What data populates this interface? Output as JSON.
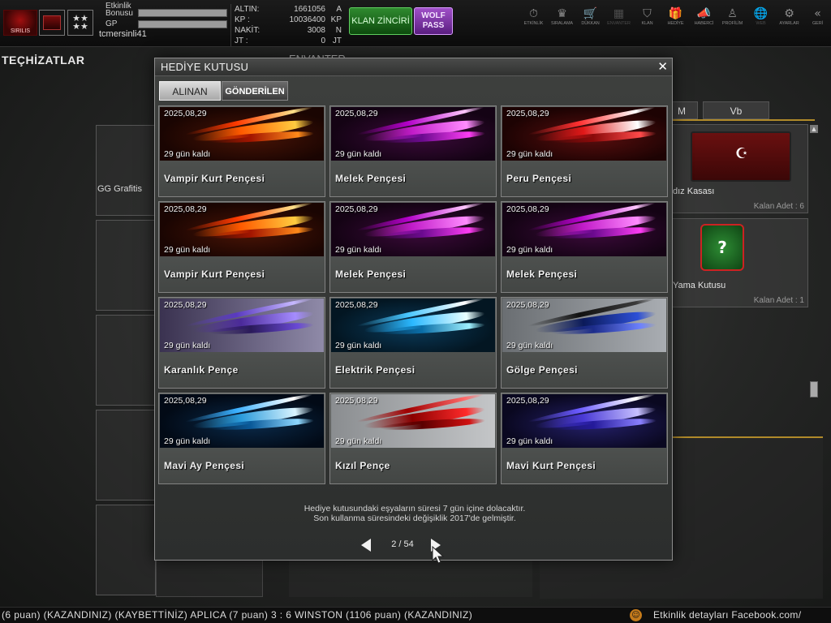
{
  "topbar": {
    "logo_text": "SIRILIS",
    "event_label": "Etkinlik Bonusu",
    "gp_label": "GP",
    "username": "tcmersinli41",
    "rank_stars": "★★ ★★",
    "currency": [
      {
        "label": "ALTIN:",
        "value": "1661056",
        "unit": "A"
      },
      {
        "label": "KP :",
        "value": "10036400",
        "unit": "KP"
      },
      {
        "label": "NAKİT:",
        "value": "3008",
        "unit": "N"
      },
      {
        "label": "JT :",
        "value": "0",
        "unit": "JT"
      }
    ],
    "klan_button": "KLAN ZİNCİRİ",
    "wolf_button": "WOLF PASS",
    "nav": [
      {
        "label": "ETKİNLİK",
        "icon": "⏱",
        "dim": false
      },
      {
        "label": "SIRALAMA",
        "icon": "♛",
        "dim": false
      },
      {
        "label": "DÜKKAN",
        "icon": "🛒",
        "dim": false
      },
      {
        "label": "ENVANTER",
        "icon": "▦",
        "dim": true
      },
      {
        "label": "KLAN",
        "icon": "⛉",
        "dim": false
      },
      {
        "label": "HEDİYE",
        "icon": "🎁",
        "dim": false
      },
      {
        "label": "HABERCİ",
        "icon": "📣",
        "dim": false
      },
      {
        "label": "PROFİLİM",
        "icon": "♙",
        "dim": false
      },
      {
        "label": "WEB",
        "icon": "🌐",
        "dim": true
      },
      {
        "label": "AYARLAR",
        "icon": "⚙",
        "dim": false
      },
      {
        "label": "GERİ",
        "icon": "«",
        "dim": false
      }
    ]
  },
  "background": {
    "tech_title": "TEÇHİZATLAR",
    "env_title": "ENVANTER",
    "gg_label": "GG Grafitis",
    "right_tabs": [
      "M",
      "Vb"
    ],
    "right_items": [
      {
        "name": "dız Kasası",
        "count": "Kalan Adet : 6"
      },
      {
        "name": "Yama Kutusu",
        "count": "Kalan Adet : 1"
      }
    ]
  },
  "dialog": {
    "title": "HEDİYE KUTUSU",
    "close": "✕",
    "tabs": {
      "received": "ALINAN",
      "sent": "GÖNDERİLEN"
    },
    "items": [
      {
        "name": "Vampir Kurt Pençesi",
        "date": "2025,08,29",
        "remaining": "29 gün kaldı",
        "style": "fire"
      },
      {
        "name": "Melek Pençesi",
        "date": "2025,08,29",
        "remaining": "29 gün kaldı",
        "style": "pink"
      },
      {
        "name": "Peru Pençesi",
        "date": "2025,08,29",
        "remaining": "29 gün kaldı",
        "style": "peru"
      },
      {
        "name": "Vampir Kurt Pençesi",
        "date": "2025,08,29",
        "remaining": "29 gün kaldı",
        "style": "fire"
      },
      {
        "name": "Melek Pençesi",
        "date": "2025,08,29",
        "remaining": "29 gün kaldı",
        "style": "pink"
      },
      {
        "name": "Melek Pençesi",
        "date": "2025,08,29",
        "remaining": "29 gün kaldı",
        "style": "pink"
      },
      {
        "name": "Karanlık Pençe",
        "date": "2025,08,29",
        "remaining": "29 gün kaldı",
        "style": "dark"
      },
      {
        "name": "Elektrik Pençesi",
        "date": "2025,08,29",
        "remaining": "29 gün kaldı",
        "style": "electric"
      },
      {
        "name": "Gölge Pençesi",
        "date": "2025,08,29",
        "remaining": "29 gün kaldı",
        "style": "shadow"
      },
      {
        "name": "Mavi Ay Pençesi",
        "date": "2025,08,29",
        "remaining": "29 gün kaldı",
        "style": "bluemoon"
      },
      {
        "name": "Kızıl Pençe",
        "date": "2025,08,29",
        "remaining": "29 gün kaldı",
        "style": "red"
      },
      {
        "name": "Mavi Kurt Pençesi",
        "date": "2025,08,29",
        "remaining": "29 gün kaldı",
        "style": "bluewolf"
      }
    ],
    "note_line1": "Hediye kutusundaki eşyaların süresi 7 gün içine dolacaktır.",
    "note_line2": "Son kullanma süresindeki değişiklik 2017'de gelmiştir.",
    "pager": {
      "text": "2 / 54"
    }
  },
  "ticker": {
    "text": "(6 puan) (KAZANDINIZ)      (KAYBETTİNİZ) APLICA (7 puan) 3 : 6 WINSTON (1106 puan) (KAZANDINIZ)",
    "event": "Etkinlik detayları Facebook.com/"
  },
  "colors": {
    "accent_gold": "#b08a2a",
    "klan_green": "#2f8a2f",
    "wolf_purple": "#a050c8"
  }
}
